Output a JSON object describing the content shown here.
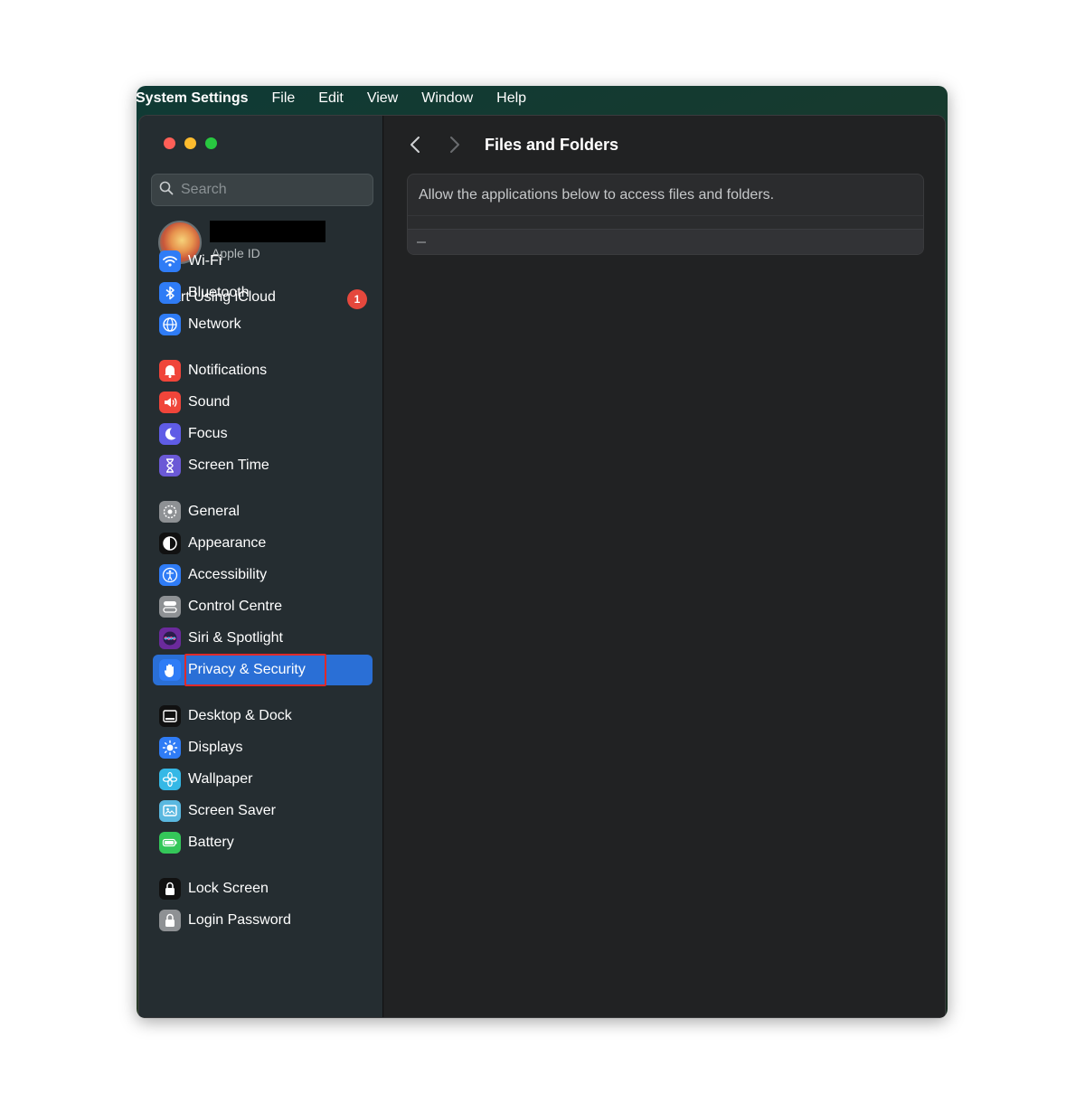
{
  "menubar": {
    "app_name": "System Settings",
    "menus": [
      "File",
      "Edit",
      "View",
      "Window",
      "Help"
    ]
  },
  "sidebar": {
    "search_placeholder": "Search",
    "profile": {
      "subtitle": "Apple ID"
    },
    "icloud": {
      "label": "Start Using iCloud",
      "badge": "1"
    },
    "items": [
      {
        "label": "Wi-Fi",
        "icon": "wifi-icon",
        "color": "#2f7cf6"
      },
      {
        "label": "Bluetooth",
        "icon": "bluetooth-icon",
        "color": "#2f7cf6"
      },
      {
        "label": "Network",
        "icon": "globe-icon",
        "color": "#2f7cf6"
      },
      {
        "label": "Notifications",
        "icon": "bell-icon",
        "color": "#f0453a"
      },
      {
        "label": "Sound",
        "icon": "speaker-icon",
        "color": "#f0453a"
      },
      {
        "label": "Focus",
        "icon": "moon-icon",
        "color": "#5f5ce6"
      },
      {
        "label": "Screen Time",
        "icon": "hourglass-icon",
        "color": "#6b59d6"
      },
      {
        "label": "General",
        "icon": "gear-icon",
        "color": "#8e9194"
      },
      {
        "label": "Appearance",
        "icon": "appearance-icon",
        "color": "#111111"
      },
      {
        "label": "Accessibility",
        "icon": "accessibility-icon",
        "color": "#2f7cf6"
      },
      {
        "label": "Control Centre",
        "icon": "toggles-icon",
        "color": "#8e9194"
      },
      {
        "label": "Siri & Spotlight",
        "icon": "siri-icon",
        "color": "#6b2a9c"
      },
      {
        "label": "Privacy & Security",
        "icon": "hand-icon",
        "color": "#2f7cf6"
      },
      {
        "label": "Desktop & Dock",
        "icon": "dock-icon",
        "color": "#111111"
      },
      {
        "label": "Displays",
        "icon": "sun-icon",
        "color": "#2f7cf6"
      },
      {
        "label": "Wallpaper",
        "icon": "flower-icon",
        "color": "#35b8e6"
      },
      {
        "label": "Screen Saver",
        "icon": "screen-saver-icon",
        "color": "#5ab8e0"
      },
      {
        "label": "Battery",
        "icon": "battery-icon",
        "color": "#34c759"
      },
      {
        "label": "Lock Screen",
        "icon": "lock-screen-icon",
        "color": "#111111"
      },
      {
        "label": "Login Password",
        "icon": "padlock-icon",
        "color": "#8e9194"
      }
    ],
    "active_item": "Privacy & Security"
  },
  "content": {
    "title": "Files and Folders",
    "description": "Allow the applications below to access files and folders."
  }
}
